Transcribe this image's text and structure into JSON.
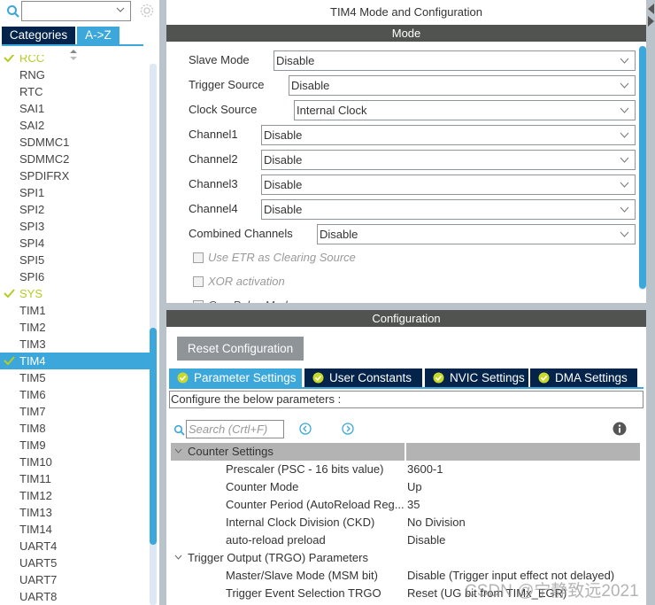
{
  "left_panel": {
    "search": {
      "value": "",
      "placeholder": ""
    },
    "tabs": [
      {
        "label": "Categories",
        "active": false
      },
      {
        "label": "A->Z",
        "active": true
      }
    ],
    "items": [
      {
        "label": "RCC",
        "status": "configured"
      },
      {
        "label": "RNG",
        "status": ""
      },
      {
        "label": "RTC",
        "status": ""
      },
      {
        "label": "SAI1",
        "status": ""
      },
      {
        "label": "SAI2",
        "status": ""
      },
      {
        "label": "SDMMC1",
        "status": ""
      },
      {
        "label": "SDMMC2",
        "status": ""
      },
      {
        "label": "SPDIFRX",
        "status": ""
      },
      {
        "label": "SPI1",
        "status": ""
      },
      {
        "label": "SPI2",
        "status": ""
      },
      {
        "label": "SPI3",
        "status": ""
      },
      {
        "label": "SPI4",
        "status": ""
      },
      {
        "label": "SPI5",
        "status": ""
      },
      {
        "label": "SPI6",
        "status": ""
      },
      {
        "label": "SYS",
        "status": "configured"
      },
      {
        "label": "TIM1",
        "status": ""
      },
      {
        "label": "TIM2",
        "status": ""
      },
      {
        "label": "TIM3",
        "status": ""
      },
      {
        "label": "TIM4",
        "status": "selected"
      },
      {
        "label": "TIM5",
        "status": ""
      },
      {
        "label": "TIM6",
        "status": ""
      },
      {
        "label": "TIM7",
        "status": ""
      },
      {
        "label": "TIM8",
        "status": ""
      },
      {
        "label": "TIM9",
        "status": ""
      },
      {
        "label": "TIM10",
        "status": ""
      },
      {
        "label": "TIM11",
        "status": ""
      },
      {
        "label": "TIM12",
        "status": ""
      },
      {
        "label": "TIM13",
        "status": ""
      },
      {
        "label": "TIM14",
        "status": ""
      },
      {
        "label": "UART4",
        "status": ""
      },
      {
        "label": "UART5",
        "status": ""
      },
      {
        "label": "UART7",
        "status": ""
      },
      {
        "label": "UART8",
        "status": ""
      }
    ]
  },
  "main": {
    "title": "TIM4 Mode and Configuration",
    "mode": {
      "header": "Mode",
      "fields": [
        {
          "label": "Slave Mode",
          "value": "Disable"
        },
        {
          "label": "Trigger Source",
          "value": "Disable"
        },
        {
          "label": "Clock Source",
          "value": "Internal Clock"
        },
        {
          "label": "Channel1",
          "value": "Disable"
        },
        {
          "label": "Channel2",
          "value": "Disable"
        },
        {
          "label": "Channel3",
          "value": "Disable"
        },
        {
          "label": "Channel4",
          "value": "Disable"
        },
        {
          "label": "Combined Channels",
          "value": "Disable"
        }
      ],
      "checkboxes": [
        {
          "label": "Use ETR as Clearing Source",
          "checked": false,
          "enabled": false
        },
        {
          "label": "XOR activation",
          "checked": false,
          "enabled": false
        },
        {
          "label": "One Pulse Mode",
          "checked": false,
          "enabled": true
        }
      ]
    },
    "configuration": {
      "header": "Configuration",
      "reset_label": "Reset Configuration",
      "tabs": [
        {
          "label": "Parameter Settings",
          "active": true
        },
        {
          "label": "User Constants",
          "active": false
        },
        {
          "label": "NVIC Settings",
          "active": false
        },
        {
          "label": "DMA Settings",
          "active": false
        }
      ],
      "instruction": "Configure the below parameters :",
      "search_placeholder": "Search (Crtl+F)",
      "groups": [
        {
          "name": "Counter Settings",
          "params": [
            {
              "key": "Prescaler (PSC - 16 bits value)",
              "value": "3600-1"
            },
            {
              "key": "Counter Mode",
              "value": "Up"
            },
            {
              "key": "Counter Period (AutoReload Reg...",
              "value": "35"
            },
            {
              "key": "Internal Clock Division (CKD)",
              "value": "No Division"
            },
            {
              "key": "auto-reload preload",
              "value": "Disable"
            }
          ]
        },
        {
          "name": "Trigger Output (TRGO) Parameters",
          "params": [
            {
              "key": "Master/Slave Mode (MSM bit)",
              "value": "Disable (Trigger input effect not delayed)"
            },
            {
              "key": "Trigger Event Selection TRGO",
              "value": "Reset (UG bit from TIMx_EGR)"
            }
          ]
        }
      ]
    }
  },
  "watermark": "CSDN @宁静致远2021",
  "colors": {
    "accent": "#3ca7da",
    "navy": "#03234b",
    "header_bar": "#505350",
    "configured_green": "#b6cc22",
    "group_row": "#b3b3b3"
  }
}
